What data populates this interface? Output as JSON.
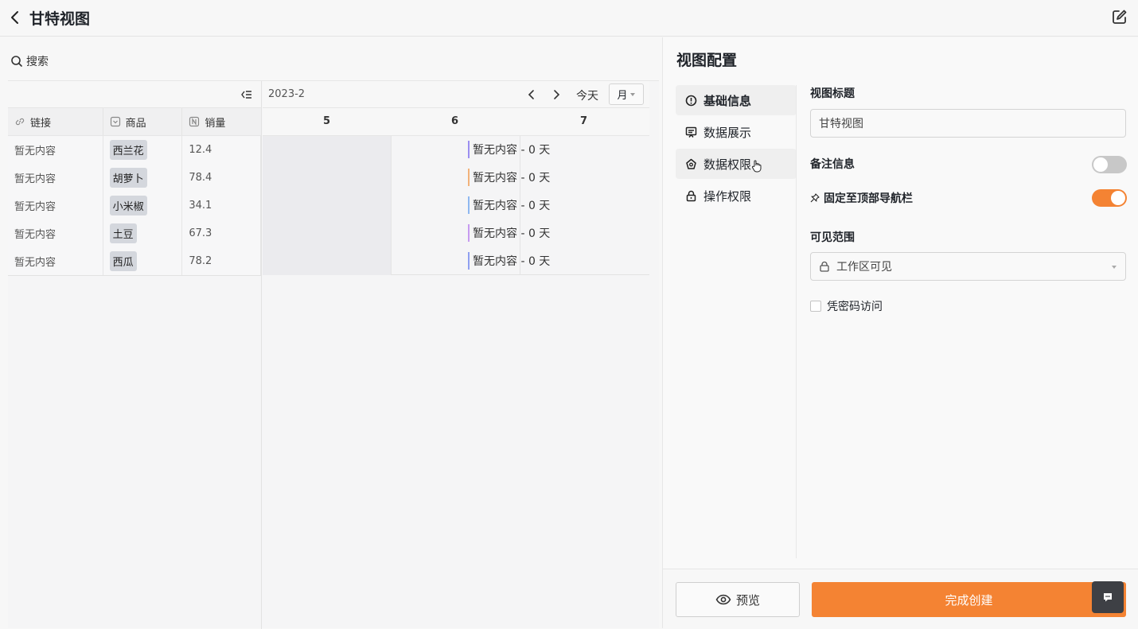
{
  "header": {
    "title": "甘特视图"
  },
  "search": {
    "label": "搜索"
  },
  "grid": {
    "columns": [
      {
        "label": "链接",
        "icon": "link-icon"
      },
      {
        "label": "商品",
        "icon": "select-field-icon"
      },
      {
        "label": "销量",
        "icon": "number-field-icon"
      }
    ],
    "rows": [
      {
        "link": "暂无内容",
        "product": "西兰花",
        "sales": "12.4"
      },
      {
        "link": "暂无内容",
        "product": "胡萝卜",
        "sales": "78.4"
      },
      {
        "link": "暂无内容",
        "product": "小米椒",
        "sales": "34.1"
      },
      {
        "link": "暂无内容",
        "product": "土豆",
        "sales": "67.3"
      },
      {
        "link": "暂无内容",
        "product": "西瓜",
        "sales": "78.2"
      }
    ]
  },
  "gantt": {
    "period": "2023-2",
    "today_label": "今天",
    "scale_label": "月",
    "days": [
      "5",
      "6",
      "7"
    ],
    "bars": [
      {
        "label": "暂无内容 - 0 天",
        "color": "#9b8ef0"
      },
      {
        "label": "暂无内容 - 0 天",
        "color": "#f2b27a"
      },
      {
        "label": "暂无内容 - 0 天",
        "color": "#8fb8f0"
      },
      {
        "label": "暂无内容 - 0 天",
        "color": "#c79bf0"
      },
      {
        "label": "暂无内容 - 0 天",
        "color": "#8f9ff0"
      }
    ]
  },
  "config": {
    "title": "视图配置",
    "menu": [
      {
        "label": "基础信息",
        "icon": "info-icon",
        "active": true
      },
      {
        "label": "数据展示",
        "icon": "display-icon"
      },
      {
        "label": "数据权限",
        "icon": "data-permission-icon"
      },
      {
        "label": "操作权限",
        "icon": "lock-icon"
      }
    ],
    "view_title_label": "视图标题",
    "view_title_value": "甘特视图",
    "remark_label": "备注信息",
    "remark_enabled": false,
    "pin_label": "固定至顶部导航栏",
    "pin_enabled": true,
    "visibility_label": "可见范围",
    "visibility_value": "工作区可见",
    "password_label": "凭密码访问",
    "preview_label": "预览",
    "create_label": "完成创建",
    "accent_color": "#f48333"
  }
}
